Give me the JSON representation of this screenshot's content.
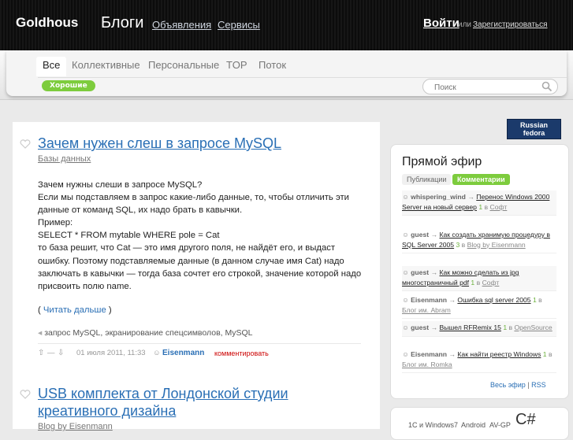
{
  "header": {
    "logo": "Goldhous",
    "section": "Блоги",
    "nav": [
      "Объявления",
      "Сервисы"
    ],
    "login": "Войти",
    "or": "или",
    "register": "Зарегистрироваться"
  },
  "tabs": {
    "items": [
      "Все",
      "Коллективные",
      "Персональные",
      "TOP",
      "Поток"
    ],
    "active": "Все",
    "sub_badge": "Хорошие"
  },
  "search": {
    "placeholder": "Поиск"
  },
  "posts": [
    {
      "title": "Зачем нужен слеш в запросе MySQL",
      "category": "Базы данных",
      "body": [
        "Зачем нужны слеши в запросе MySQL?",
        "Если мы подставляем в запрос какие-либо данные, то, чтобы отличить эти данные от команд SQL, их надо брать в кавычки.",
        "Пример:",
        "SELECT * FROM mytable WHERE pole = Cat",
        "то база решит, что Cat — это имя другого поля, не найдёт его, и выдаст ошибку. Поэтому подставляемые данные (в данном случае имя Cat) надо заключать в кавычки — тогда база сочтет его строкой, значение которой надо присвоить полю name."
      ],
      "readmore_prefix": "( ",
      "readmore": "Читать дальше",
      "readmore_suffix": " )",
      "tags": "запрос MySQL, экранирование спецсимволов, MySQL",
      "vote": "—",
      "date": "01 июля 2011, 11:33",
      "author": "Eisenmann",
      "comment": "комментировать"
    },
    {
      "title": "USB комплекта от Лондонской студии креативного дизайна",
      "category": "Blog by Eisenmann"
    }
  ],
  "sidebar": {
    "banner_line1": "Russian",
    "banner_line2": "fedora",
    "live_title": "Прямой эфир",
    "live_tabs": [
      "Публикации",
      "Комментарии"
    ],
    "live_items": [
      {
        "user": "whispering_wind",
        "post": "Перенос Windows 2000 Server на новый сервер",
        "count": "1",
        "in": "в",
        "blog": "Софт"
      },
      {
        "user": "guest",
        "post": "Как создать хранимую процедуру в SQL Server 2005",
        "count": "3",
        "in": "в",
        "blog": "Blog by Eisenmann"
      },
      {
        "user": "guest",
        "post": "Как можно сделать из jpg многостраничный pdf",
        "count": "1",
        "in": "в",
        "blog": "Софт"
      },
      {
        "user": "Eisenmann",
        "post": "Ошибка sql server 2005",
        "count": "1",
        "in": "в",
        "blog": "Блог им. Abram"
      },
      {
        "user": "guest",
        "post": "Вышел RFRemix 15",
        "count": "1",
        "in": "в",
        "blog": "OpenSource"
      },
      {
        "user": "Eisenmann",
        "post": "Как найти реестр Windows",
        "count": "1",
        "in": "в",
        "blog": "Блог им. Romka"
      }
    ],
    "live_all": "Весь эфир",
    "live_sep": "|",
    "live_rss": "RSS",
    "tagcloud": [
      "1C и Windows7",
      "Android",
      "AV-GP",
      "C#"
    ]
  },
  "colors": {
    "accent_green": "#7dcc3d",
    "link_blue": "#2a6fb5",
    "header_bg": "#111111"
  }
}
